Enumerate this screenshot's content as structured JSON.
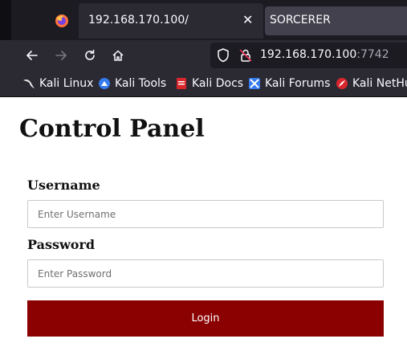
{
  "browser": {
    "active_tab": {
      "title": "192.168.170.100/",
      "close_glyph": "✕"
    },
    "second_tab": {
      "title": "SORCERER"
    },
    "url": {
      "host": "192.168.170.100",
      "port": ":7742"
    },
    "nav_icons": [
      "back-arrow-icon",
      "forward-arrow-icon",
      "reload-icon",
      "home-icon"
    ],
    "bookmarks": [
      {
        "label": "Kali Linux",
        "icon": "kali-dragon-icon"
      },
      {
        "label": "Kali Tools",
        "icon": "kali-tools-icon"
      },
      {
        "label": "Kali Docs",
        "icon": "kali-docs-icon"
      },
      {
        "label": "Kali Forums",
        "icon": "kali-forums-icon"
      },
      {
        "label": "Kali NetHu",
        "icon": "kali-nethunter-icon"
      }
    ],
    "colors": {
      "tabbar": "#1c1b22",
      "toolbar": "#2b2a33",
      "text": "#fbfbfe"
    }
  },
  "page": {
    "title": "Control Panel",
    "username_label": "Username",
    "username_placeholder": "Enter Username",
    "password_label": "Password",
    "password_placeholder": "Enter Password",
    "login_label": "Login",
    "accent_color": "#8b0000"
  }
}
